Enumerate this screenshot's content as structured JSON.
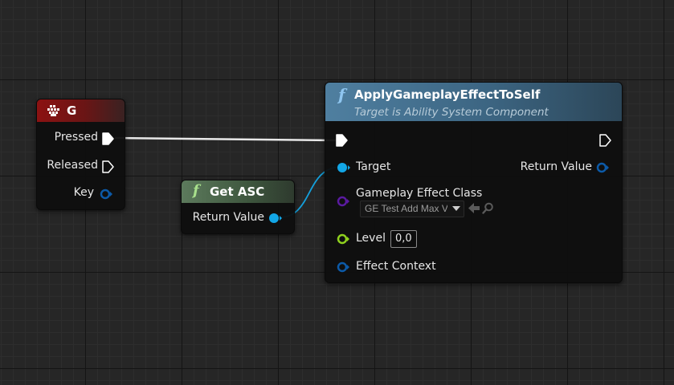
{
  "nodes": {
    "key_g": {
      "title": "G",
      "pins": {
        "pressed": "Pressed",
        "released": "Released",
        "key": "Key"
      }
    },
    "get_asc": {
      "icon": "function-icon",
      "title": "Get ASC",
      "pins": {
        "return_value": "Return Value"
      }
    },
    "apply_ge": {
      "icon": "function-icon",
      "title": "ApplyGameplayEffectToSelf",
      "subtitle": "Target is Ability System Component",
      "pins": {
        "target": "Target",
        "return_value": "Return Value",
        "effect_class": "Gameplay Effect Class",
        "effect_class_value": "GE Test Add Max V",
        "level": "Level",
        "level_value": "0,0",
        "effect_context": "Effect Context"
      }
    }
  },
  "colors": {
    "exec_pin": "#ffffff",
    "object_pin": "#12a6e6",
    "struct_pin": "#0c5aa8",
    "class_pin": "#5a1aa0",
    "float_pin": "#8fd11e",
    "key_header": "#8a1414",
    "pure_header": "#4a6a4a",
    "function_header": "#47708e"
  }
}
